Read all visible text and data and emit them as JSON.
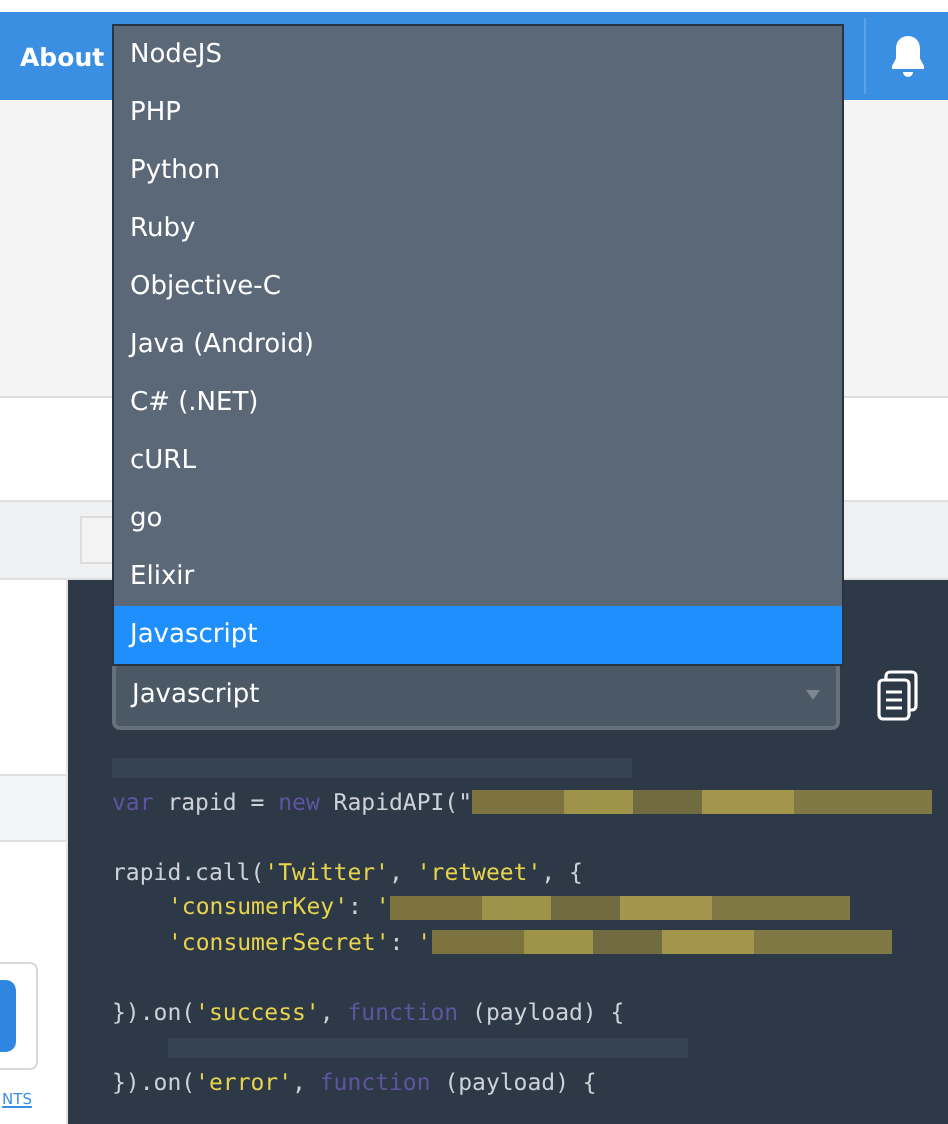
{
  "header": {
    "title": "About"
  },
  "language_menu": {
    "options": [
      {
        "label": "NodeJS",
        "selected": false
      },
      {
        "label": "PHP",
        "selected": false
      },
      {
        "label": "Python",
        "selected": false
      },
      {
        "label": "Ruby",
        "selected": false
      },
      {
        "label": "Objective-C",
        "selected": false
      },
      {
        "label": "Java (Android)",
        "selected": false
      },
      {
        "label": "C# (.NET)",
        "selected": false
      },
      {
        "label": "cURL",
        "selected": false
      },
      {
        "label": "go",
        "selected": false
      },
      {
        "label": "Elixir",
        "selected": false
      },
      {
        "label": "Javascript",
        "selected": true
      }
    ]
  },
  "language_select": {
    "value": "Javascript"
  },
  "code_lines": [
    {
      "kind": "code",
      "indented": false,
      "tokens": [
        {
          "kind": "comment_blur"
        }
      ]
    },
    {
      "kind": "code",
      "indented": false,
      "tokens": [
        {
          "kind": "keyword",
          "text": "var"
        },
        {
          "kind": "plain",
          "text": " rapid = "
        },
        {
          "kind": "keyword",
          "text": "new"
        },
        {
          "kind": "plain",
          "text": " RapidAPI(\""
        },
        {
          "kind": "redacted"
        }
      ]
    },
    {
      "kind": "blank"
    },
    {
      "kind": "code",
      "indented": false,
      "tokens": [
        {
          "kind": "plain",
          "text": "rapid.call("
        },
        {
          "kind": "string",
          "text": "'Twitter'"
        },
        {
          "kind": "plain",
          "text": ", "
        },
        {
          "kind": "string",
          "text": "'retweet'"
        },
        {
          "kind": "plain",
          "text": ", {"
        }
      ]
    },
    {
      "kind": "code",
      "indented": true,
      "tokens": [
        {
          "kind": "string",
          "text": "'consumerKey'"
        },
        {
          "kind": "plain",
          "text": ": "
        },
        {
          "kind": "string",
          "text": "'"
        },
        {
          "kind": "redacted"
        }
      ]
    },
    {
      "kind": "code",
      "indented": true,
      "tokens": [
        {
          "kind": "string",
          "text": "'consumerSecret'"
        },
        {
          "kind": "plain",
          "text": ": "
        },
        {
          "kind": "string",
          "text": "'"
        },
        {
          "kind": "redacted"
        }
      ]
    },
    {
      "kind": "blank"
    },
    {
      "kind": "code",
      "indented": false,
      "tokens": [
        {
          "kind": "plain",
          "text": "}).on("
        },
        {
          "kind": "string",
          "text": "'success'"
        },
        {
          "kind": "plain",
          "text": ", "
        },
        {
          "kind": "keyword",
          "text": "function"
        },
        {
          "kind": "plain",
          "text": " (payload) {"
        }
      ]
    },
    {
      "kind": "code",
      "indented": true,
      "tokens": [
        {
          "kind": "comment_blur"
        }
      ]
    },
    {
      "kind": "code",
      "indented": false,
      "tokens": [
        {
          "kind": "plain",
          "text": "}).on("
        },
        {
          "kind": "string",
          "text": "'error'"
        },
        {
          "kind": "plain",
          "text": ", "
        },
        {
          "kind": "keyword",
          "text": "function"
        },
        {
          "kind": "plain",
          "text": " (payload) {"
        }
      ]
    }
  ],
  "sidebar": {
    "link": "NTS"
  }
}
